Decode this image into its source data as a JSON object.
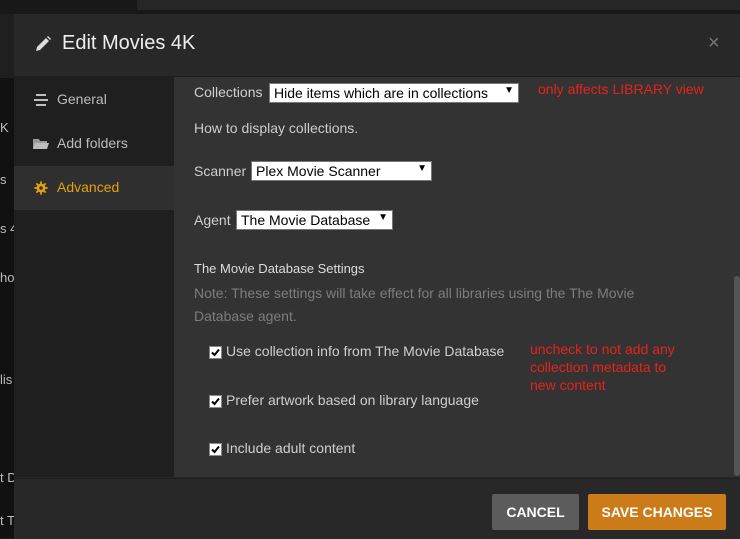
{
  "background": {
    "left_fragments": [
      "K",
      "s",
      "s 4",
      "ho",
      "lis",
      "t D",
      "t T"
    ]
  },
  "modal": {
    "title": "Edit Movies 4K",
    "close_glyph": "×"
  },
  "sidebar": {
    "items": [
      {
        "label": "General",
        "icon": "list-icon",
        "active": false
      },
      {
        "label": "Add folders",
        "icon": "folder-icon",
        "active": false
      },
      {
        "label": "Advanced",
        "icon": "gear-icon",
        "active": true
      }
    ]
  },
  "advanced": {
    "collections": {
      "label": "Collections",
      "value": "Hide items which are in collections",
      "hint": "How to display collections.",
      "annotation": "only affects LIBRARY view"
    },
    "scanner": {
      "label": "Scanner",
      "value": "Plex Movie Scanner"
    },
    "agent": {
      "label": "Agent",
      "value": "The Movie Database"
    },
    "agent_settings": {
      "title": "The Movie Database Settings",
      "note": "Note: These settings will take effect for all libraries using the The Movie Database agent.",
      "options": [
        {
          "label": "Use collection info from The Movie Database",
          "checked": true
        },
        {
          "label": "Prefer artwork based on library language",
          "checked": true
        },
        {
          "label": "Include adult content",
          "checked": true
        }
      ],
      "annotation": [
        "uncheck to not add any",
        "collection metadata to",
        "new content"
      ]
    }
  },
  "footer": {
    "cancel_label": "CANCEL",
    "save_label": "SAVE CHANGES"
  },
  "colors": {
    "accent": "#e5a00d",
    "save_button": "#cc7b19",
    "annotation": "#e5231b"
  }
}
